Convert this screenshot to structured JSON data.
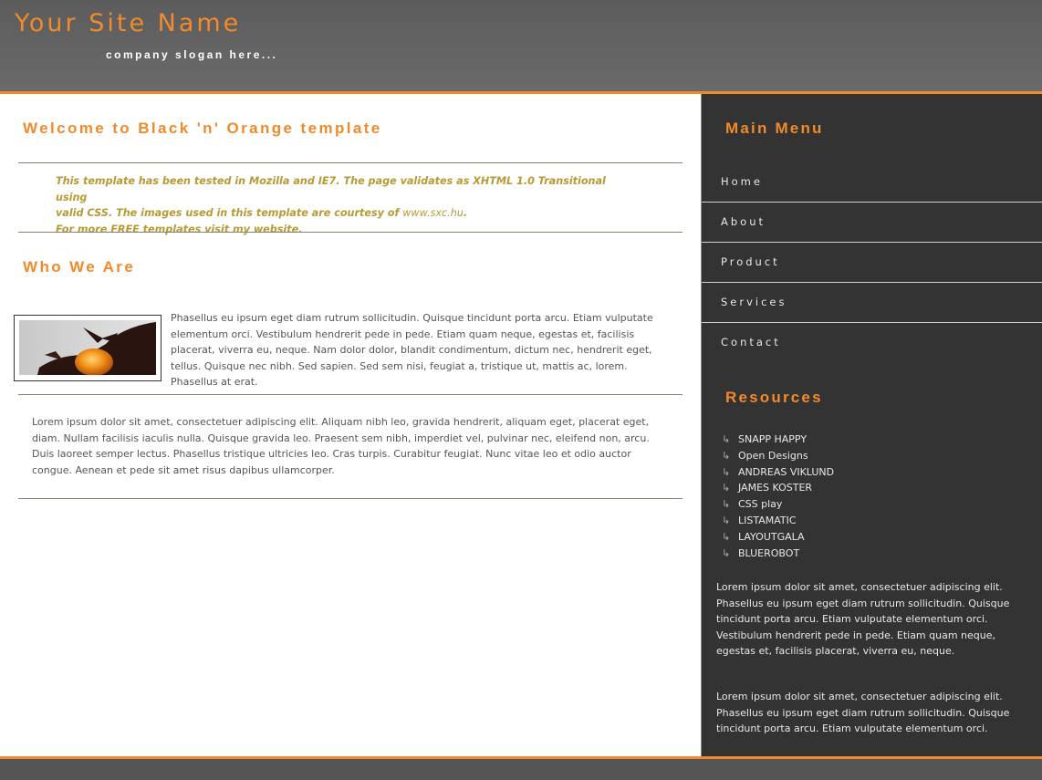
{
  "header": {
    "site_name": "Your Site Name",
    "slogan": "company slogan here..."
  },
  "main": {
    "welcome_title": "Welcome to Black 'n' Orange template",
    "intro_line1": "This template has been tested in Mozilla and IE7. The page validates as XHTML 1.0 Transitional using",
    "intro_line2_pre": "valid CSS. The images used in this template are courtesy of ",
    "intro_link": "www.sxc.hu",
    "intro_line2_post": ".",
    "intro_line3": "For more FREE templates visit my website.",
    "who_title": "Who We Are",
    "para1": "Phasellus eu ipsum eget diam rutrum sollicitudin. Quisque tincidunt porta arcu. Etiam vulputate elementum orci. Vestibulum hendrerit pede in pede. Etiam quam neque, egestas et, facilisis placerat, viverra eu, neque. Nam dolor dolor, blandit condimentum, dictum nec, hendrerit eget, tellus. Quisque nec nibh. Sed sapien. Sed sem nisi, feugiat a, tristique ut, mattis ac, lorem. Phasellus at erat.",
    "para2": "Lorem ipsum dolor sit amet, consectetuer adipiscing elit. Aliquam nibh leo, gravida hendrerit, aliquam eget, placerat eget, diam. Nullam facilisis iaculis nulla. Quisque gravida leo. Praesent sem nibh, imperdiet vel, pulvinar nec, eleifend non, arcu. Duis laoreet semper lectus. Phasellus tristique ultricies leo. Cras turpis. Curabitur feugiat. Nunc vitae leo et odio auctor congue. Aenean et pede sit amet risus dapibus ullamcorper."
  },
  "sidebar": {
    "menu_title": "Main Menu",
    "menu": [
      {
        "label": "Home"
      },
      {
        "label": "About"
      },
      {
        "label": "Product"
      },
      {
        "label": "Services"
      },
      {
        "label": "Contact"
      }
    ],
    "resources_title": "Resources",
    "resources": [
      {
        "label": "SNAPP HAPPY"
      },
      {
        "label": "Open Designs"
      },
      {
        "label": "ANDREAS VIKLUND"
      },
      {
        "label": "JAMES KOSTER"
      },
      {
        "label": "CSS play"
      },
      {
        "label": "LISTAMATIC"
      },
      {
        "label": "LAYOUTGALA"
      },
      {
        "label": "BLUEROBOT"
      }
    ],
    "text1": "Lorem ipsum dolor sit amet, consectetuer adipiscing elit. Phasellus eu ipsum eget diam rutrum sollicitudin. Quisque tincidunt porta arcu. Etiam vulputate elementum orci. Vestibulum hendrerit pede in pede. Etiam quam neque, egestas et, facilisis placerat, viverra eu, neque.",
    "text2": "Lorem ipsum dolor sit amet, consectetuer adipiscing elit. Phasellus eu ipsum eget diam rutrum sollicitudin. Quisque tincidunt porta arcu. Etiam vulputate elementum orci."
  },
  "colors": {
    "accent": "#f08a2a",
    "header_bg": "#636363",
    "sidebar_bg": "#333333",
    "intro_text": "#b69a33"
  },
  "icons": {
    "resource_bullet": "arrow-hook-icon",
    "photo": "hand-holding-orange-egg-image"
  }
}
